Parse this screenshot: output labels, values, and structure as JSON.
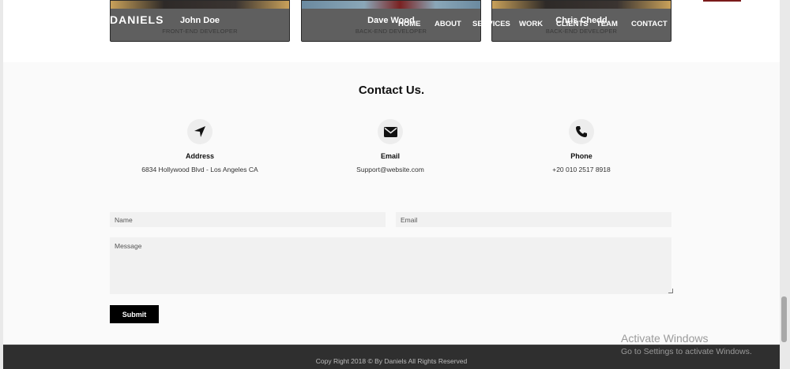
{
  "navbar": {
    "brand": "DANIELS",
    "items": [
      "HOME",
      "ABOUT",
      "SERVICES",
      "WORK",
      "CLIENTS",
      "TEAM",
      "CONTACT"
    ]
  },
  "team": {
    "members": [
      {
        "name": "John Doe",
        "role": "FRONT-END DEVELOPER"
      },
      {
        "name": "Dave Wood",
        "role": "BACK-END DEVELOPER"
      },
      {
        "name": "Chris Chedd",
        "role": "BACK-END DEVELOPER"
      }
    ]
  },
  "contact": {
    "title": "Contact Us.",
    "info": [
      {
        "icon": "location-arrow-icon",
        "title": "Address",
        "value": "6834 Hollywood Blvd - Los Angeles CA"
      },
      {
        "icon": "envelope-icon",
        "title": "Email",
        "value": "Support@website.com"
      },
      {
        "icon": "phone-icon",
        "title": "Phone",
        "value": "+20 010 2517 8918"
      }
    ],
    "form": {
      "name_placeholder": "Name",
      "email_placeholder": "Email",
      "message_placeholder": "Message",
      "submit_label": "Submit"
    }
  },
  "footer": {
    "text": "Copy Right 2018 © By Daniels All Rights Reserved"
  },
  "watermark": {
    "line1": "Activate Windows",
    "line2": "Go to Settings to activate Windows."
  },
  "colors": {
    "footer_bg": "#2f2f2f",
    "submit_bg": "#000000",
    "field_bg": "#f1f1f1"
  }
}
